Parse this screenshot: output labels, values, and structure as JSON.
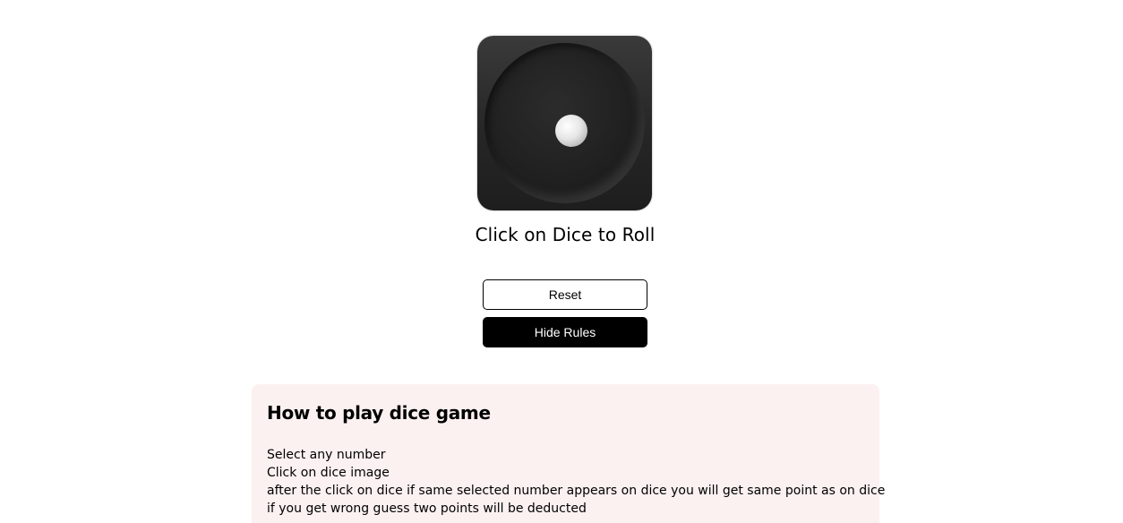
{
  "game": {
    "roll_prompt": "Click on Dice to Roll",
    "dice_value": 1
  },
  "buttons": {
    "reset_label": "Reset",
    "hide_rules_label": "Hide Rules"
  },
  "rules": {
    "title": "How to play dice game",
    "lines": [
      "Select any number",
      "Click on dice image",
      "after the click on dice if same selected number appears on dice you will get same point as on dice",
      "if you get wrong guess two points will be deducted"
    ]
  },
  "colors": {
    "rules_background": "#fbf1f0",
    "primary_button": "#000000",
    "secondary_button": "#ffffff"
  }
}
